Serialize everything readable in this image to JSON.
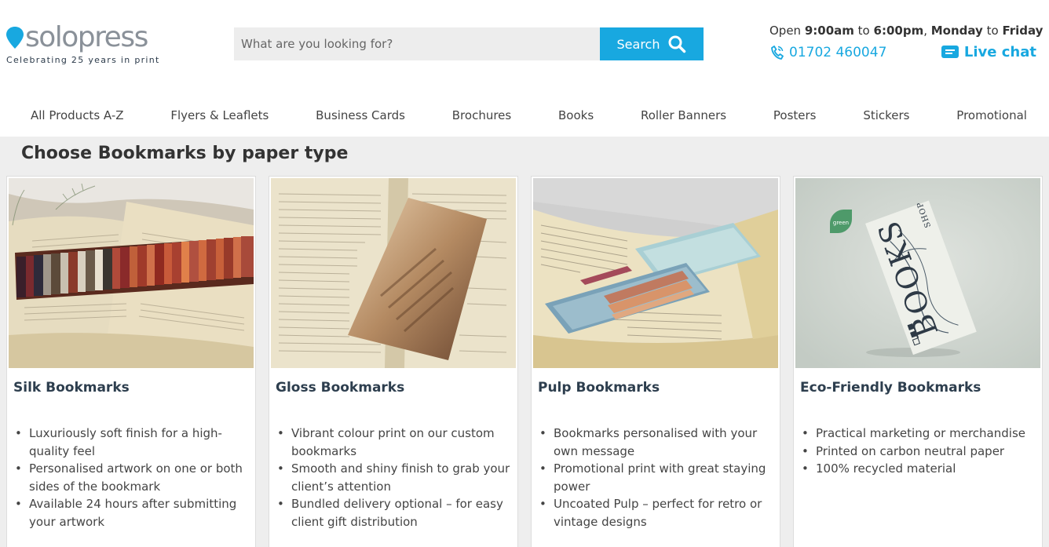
{
  "brand": {
    "name": "solopress",
    "tagline": "Celebrating 25 years in print",
    "pin_color": "#18a8e0"
  },
  "search": {
    "placeholder": "What are you looking for?",
    "button_label": "Search"
  },
  "contact": {
    "hours_prefix": "Open ",
    "open_time": "9:00am",
    "to1": " to ",
    "close_time": "6:00pm",
    "comma": ", ",
    "day_from": "Monday",
    "to2": " to ",
    "day_to": "Friday",
    "phone": "01702 460047",
    "livechat": "Live chat"
  },
  "nav": {
    "items": [
      {
        "label": "All Products A-Z"
      },
      {
        "label": "Flyers & Leaflets"
      },
      {
        "label": "Business Cards"
      },
      {
        "label": "Brochures"
      },
      {
        "label": "Books"
      },
      {
        "label": "Roller Banners"
      },
      {
        "label": "Posters"
      },
      {
        "label": "Stickers"
      },
      {
        "label": "Promotional"
      }
    ]
  },
  "section": {
    "title": "Choose Bookmarks by paper type"
  },
  "cards": [
    {
      "title": "Silk Bookmarks",
      "bullets": [
        "Luxuriously soft finish for a high-quality feel",
        "Personalised artwork on one or both sides of the bookmark",
        "Available 24 hours after submitting your artwork"
      ]
    },
    {
      "title": "Gloss Bookmarks",
      "bullets": [
        "Vibrant colour print on our custom bookmarks",
        "Smooth and shiny finish to grab your client’s attention",
        "Bundled delivery optional – for easy client gift distribution"
      ]
    },
    {
      "title": "Pulp Bookmarks",
      "bullets": [
        "Bookmarks personalised with your own message",
        "Promotional print with great staying power",
        "Uncoated Pulp – perfect for retro or vintage designs"
      ]
    },
    {
      "title": "Eco-Friendly Bookmarks",
      "badge": "green",
      "bookmark_text": "BOOKS",
      "bookmark_small": "SHOP",
      "bullets": [
        "Practical marketing or merchandise",
        "Printed on carbon neutral paper",
        "100% recycled material"
      ]
    }
  ],
  "colors": {
    "accent": "#18a8e0",
    "section_bg": "#eeeeee",
    "title_text": "#2d3e4e"
  }
}
